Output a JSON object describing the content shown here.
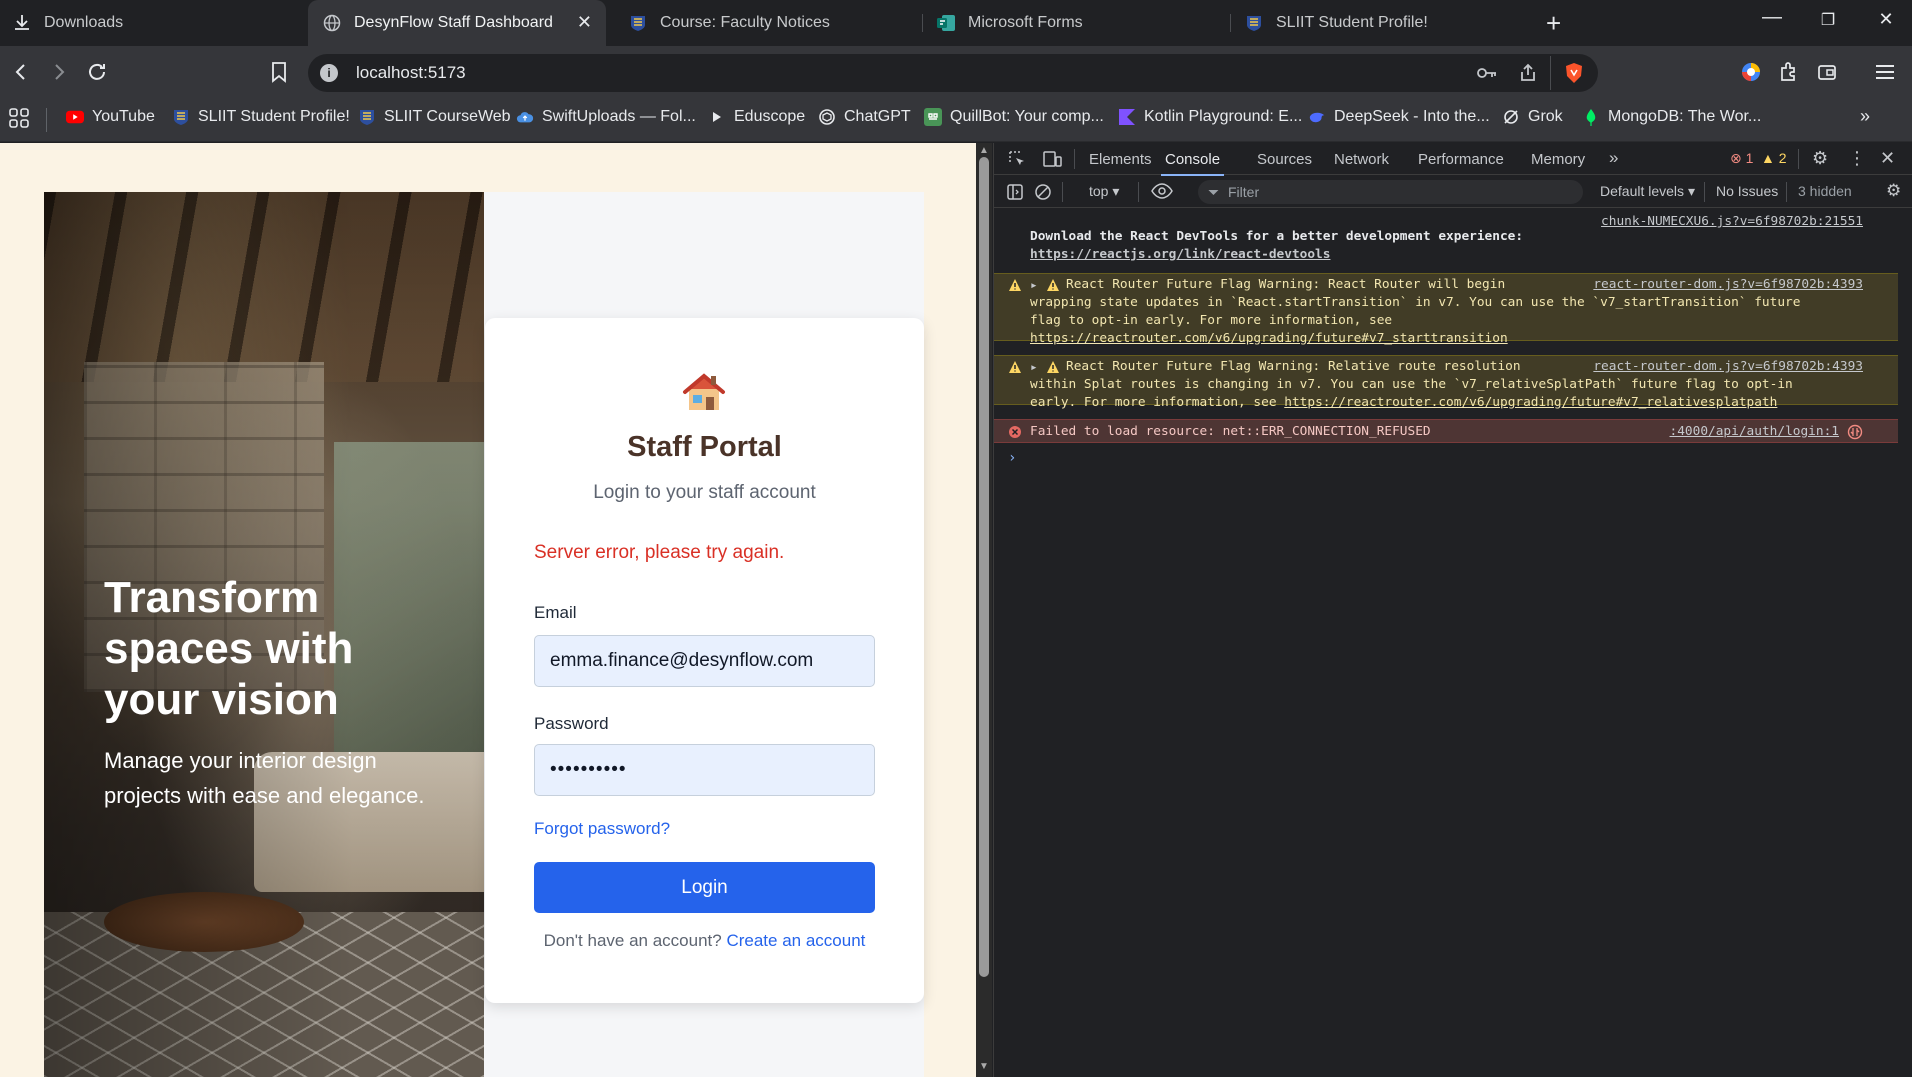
{
  "tabs": [
    {
      "title": "Downloads",
      "icon": "download-icon"
    },
    {
      "title": "DesynFlow Staff Dashboard",
      "icon": "globe-icon",
      "active": true
    },
    {
      "title": "Course: Faculty Notices",
      "icon": "sliit-crest-icon"
    },
    {
      "title": "Microsoft Forms",
      "icon": "forms-icon"
    },
    {
      "title": "SLIIT Student Profile!",
      "icon": "sliit-crest-icon"
    }
  ],
  "window_controls": {
    "minimize": "—",
    "restore": "❐",
    "close": "✕"
  },
  "address_bar": {
    "url": "localhost:5173"
  },
  "bookmarks": [
    {
      "label": "YouTube",
      "icon": "youtube-icon"
    },
    {
      "label": "SLIIT Student Profile!",
      "icon": "sliit-crest-icon"
    },
    {
      "label": "SLIIT CourseWeb",
      "icon": "sliit-crest-icon"
    },
    {
      "label": "SwiftUploads — Fol...",
      "icon": "cloud-icon"
    },
    {
      "label": "Eduscope",
      "icon": "play-icon"
    },
    {
      "label": "ChatGPT",
      "icon": "openai-icon"
    },
    {
      "label": "QuillBot: Your comp...",
      "icon": "quillbot-icon"
    },
    {
      "label": "Kotlin Playground: E...",
      "icon": "kotlin-icon"
    },
    {
      "label": "DeepSeek - Into the...",
      "icon": "deepseek-icon"
    },
    {
      "label": "Grok",
      "icon": "grok-icon"
    },
    {
      "label": "MongoDB: The Wor...",
      "icon": "mongodb-icon"
    }
  ],
  "hero": {
    "heading": "Transform spaces with your vision",
    "subheading": "Manage your interior design projects with ease and elegance."
  },
  "login": {
    "title": "Staff Portal",
    "subtitle": "Login to your staff account",
    "error": "Server error, please try again.",
    "email_label": "Email",
    "email_value": "emma.finance@desynflow.com",
    "password_label": "Password",
    "password_value": "••••••••••",
    "forgot": "Forgot password?",
    "login_button": "Login",
    "signup_prompt": "Don't have an account?",
    "signup_link": "Create an account"
  },
  "devtools": {
    "tabs": [
      "Elements",
      "Console",
      "Sources",
      "Network",
      "Performance",
      "Memory"
    ],
    "active_tab": "Console",
    "error_count": "1",
    "warning_count": "2",
    "context": "top",
    "filter_placeholder": "Filter",
    "levels": "Default levels",
    "issues": "No Issues",
    "hidden": "3 hidden",
    "messages": [
      {
        "type": "info",
        "source": "chunk-NUMECXU6.js?v=6f98702b:21551",
        "lines": [
          "Download the React DevTools for a better development experience:"
        ],
        "link": "https://reactjs.org/link/react-devtools"
      },
      {
        "type": "warning",
        "source": "react-router-dom.js?v=6f98702b:4393",
        "lines": [
          "React Router Future Flag Warning: React Router will begin",
          "wrapping state updates in `React.startTransition` in v7. You can use the `v7_startTransition` future",
          "flag to opt-in early. For more information, see"
        ],
        "link": "https://reactrouter.com/v6/upgrading/future#v7_starttransition"
      },
      {
        "type": "warning",
        "source": "react-router-dom.js?v=6f98702b:4393",
        "lines": [
          "React Router Future Flag Warning: Relative route resolution",
          "within Splat routes is changing in v7. You can use the `v7_relativeSplatPath` future flag to opt-in",
          "early. For more information, see"
        ],
        "link": "https://reactrouter.com/v6/upgrading/future#v7_relativesplatpath"
      },
      {
        "type": "error",
        "source": ":4000/api/auth/login:1",
        "lines": [
          "Failed to load resource: net::ERR_CONNECTION_REFUSED"
        ]
      }
    ]
  },
  "colors": {
    "primary": "#2563eb",
    "error": "#d93025",
    "title": "#4a3328"
  }
}
